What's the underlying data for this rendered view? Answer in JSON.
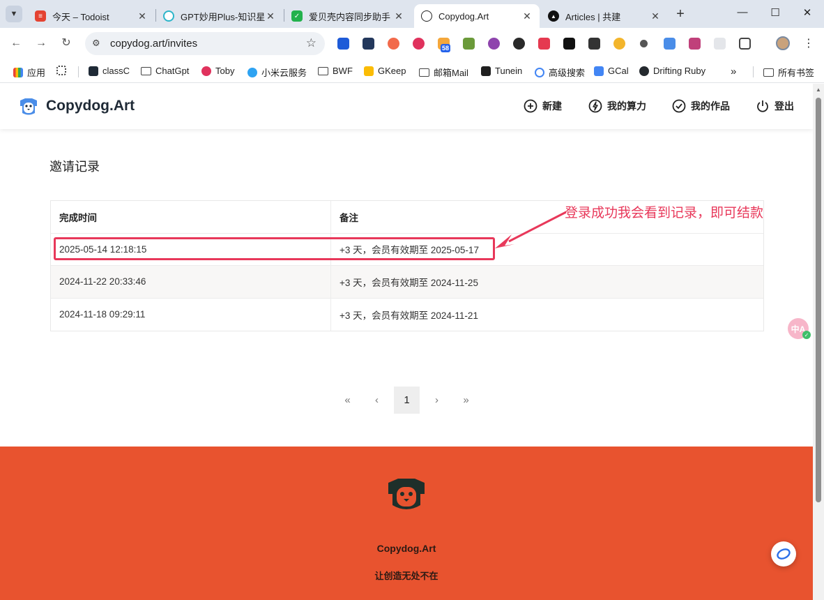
{
  "browser": {
    "tabs": [
      {
        "label": "今天 – Todoist",
        "color": "#e44332",
        "glyph": "≡"
      },
      {
        "label": "GPT妙用Plus-知识星",
        "color": "#2bb5c9",
        "glyph": "◌"
      },
      {
        "label": "爱贝壳内容同步助手",
        "color": "#22b14c",
        "glyph": "✓"
      },
      {
        "label": "Copydog.Art",
        "color": "#222222",
        "glyph": "●"
      },
      {
        "label": "Articles | 共建",
        "color": "#111111",
        "glyph": "▲"
      }
    ],
    "address": "copydog.art/invites",
    "extension_badge": "58",
    "bookmarks": [
      {
        "label": "应用"
      },
      {
        "label": "classC"
      },
      {
        "label": "ChatGpt"
      },
      {
        "label": "Toby"
      },
      {
        "label": "小米云服务"
      },
      {
        "label": "BWF"
      },
      {
        "label": "GKeep"
      },
      {
        "label": "邮箱Mail"
      },
      {
        "label": "Tunein"
      },
      {
        "label": "高级搜索"
      },
      {
        "label": "GCal"
      },
      {
        "label": "Drifting Ruby"
      },
      {
        "label": "所有书签"
      }
    ],
    "icons": {
      "tab_menu": "chevron-down-icon",
      "close": "close-icon",
      "new_tab": "plus-icon",
      "back": "arrow-left-icon",
      "forward": "arrow-right-icon",
      "reload": "reload-icon",
      "star": "star-icon"
    }
  },
  "site": {
    "brand": "Copydog.Art",
    "nav": [
      {
        "label": "新建",
        "icon": "plus-circle-icon"
      },
      {
        "label": "我的算力",
        "icon": "bolt-icon"
      },
      {
        "label": "我的作品",
        "icon": "check-circle-icon"
      },
      {
        "label": "登出",
        "icon": "power-icon"
      }
    ],
    "accent": "#e8532f"
  },
  "main": {
    "title": "邀请记录",
    "table": {
      "headers": [
        "完成时间",
        "备注"
      ],
      "rows": [
        [
          "2025-05-14 12:18:15",
          "+3 天，会员有效期至 2025-05-17"
        ],
        [
          "2024-11-22 20:33:46",
          "+3 天，会员有效期至 2024-11-25"
        ],
        [
          "2024-11-18 09:29:11",
          "+3 天，会员有效期至 2024-11-21"
        ]
      ]
    },
    "annotation": {
      "text": "登录成功我会看到记录，即可结款",
      "color": "#e8385a"
    },
    "pagination": {
      "first": "«",
      "prev": "‹",
      "current": "1",
      "next": "›",
      "last": "»"
    }
  },
  "footer": {
    "brand": "Copydog.Art",
    "slogan": "让创造无处不在"
  },
  "widgets": {
    "translate_label": "中A"
  }
}
